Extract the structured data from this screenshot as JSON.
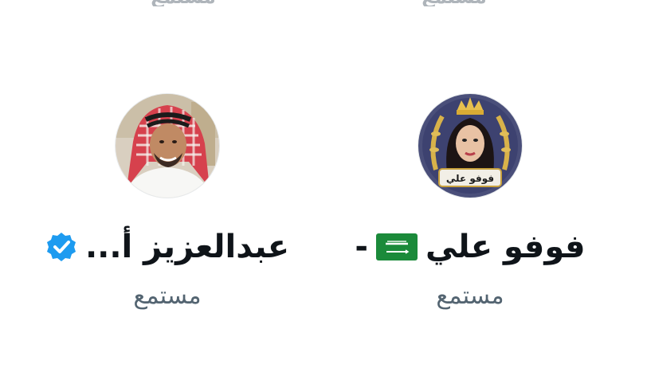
{
  "top_cutoff": {
    "left_text": "مستمع",
    "right_text": "مستمع"
  },
  "listeners": [
    {
      "name": "عبدالعزيز أ...",
      "role": "مستمع",
      "verified": true,
      "badge_color": "#1d9bf0",
      "avatar_desc": "man-in-red-shemagh-avatar"
    },
    {
      "name": "فوفو علي",
      "name_suffix": "-",
      "flag": "saudi-flag-icon",
      "role": "مستمع",
      "avatar_label": "فوفو علي",
      "avatar_desc": "woman-with-crown-avatar"
    }
  ],
  "colors": {
    "name_text": "#0f1419",
    "role_text": "#536471",
    "verified_badge": "#1d9bf0",
    "flag_green": "#1b8a3a"
  }
}
